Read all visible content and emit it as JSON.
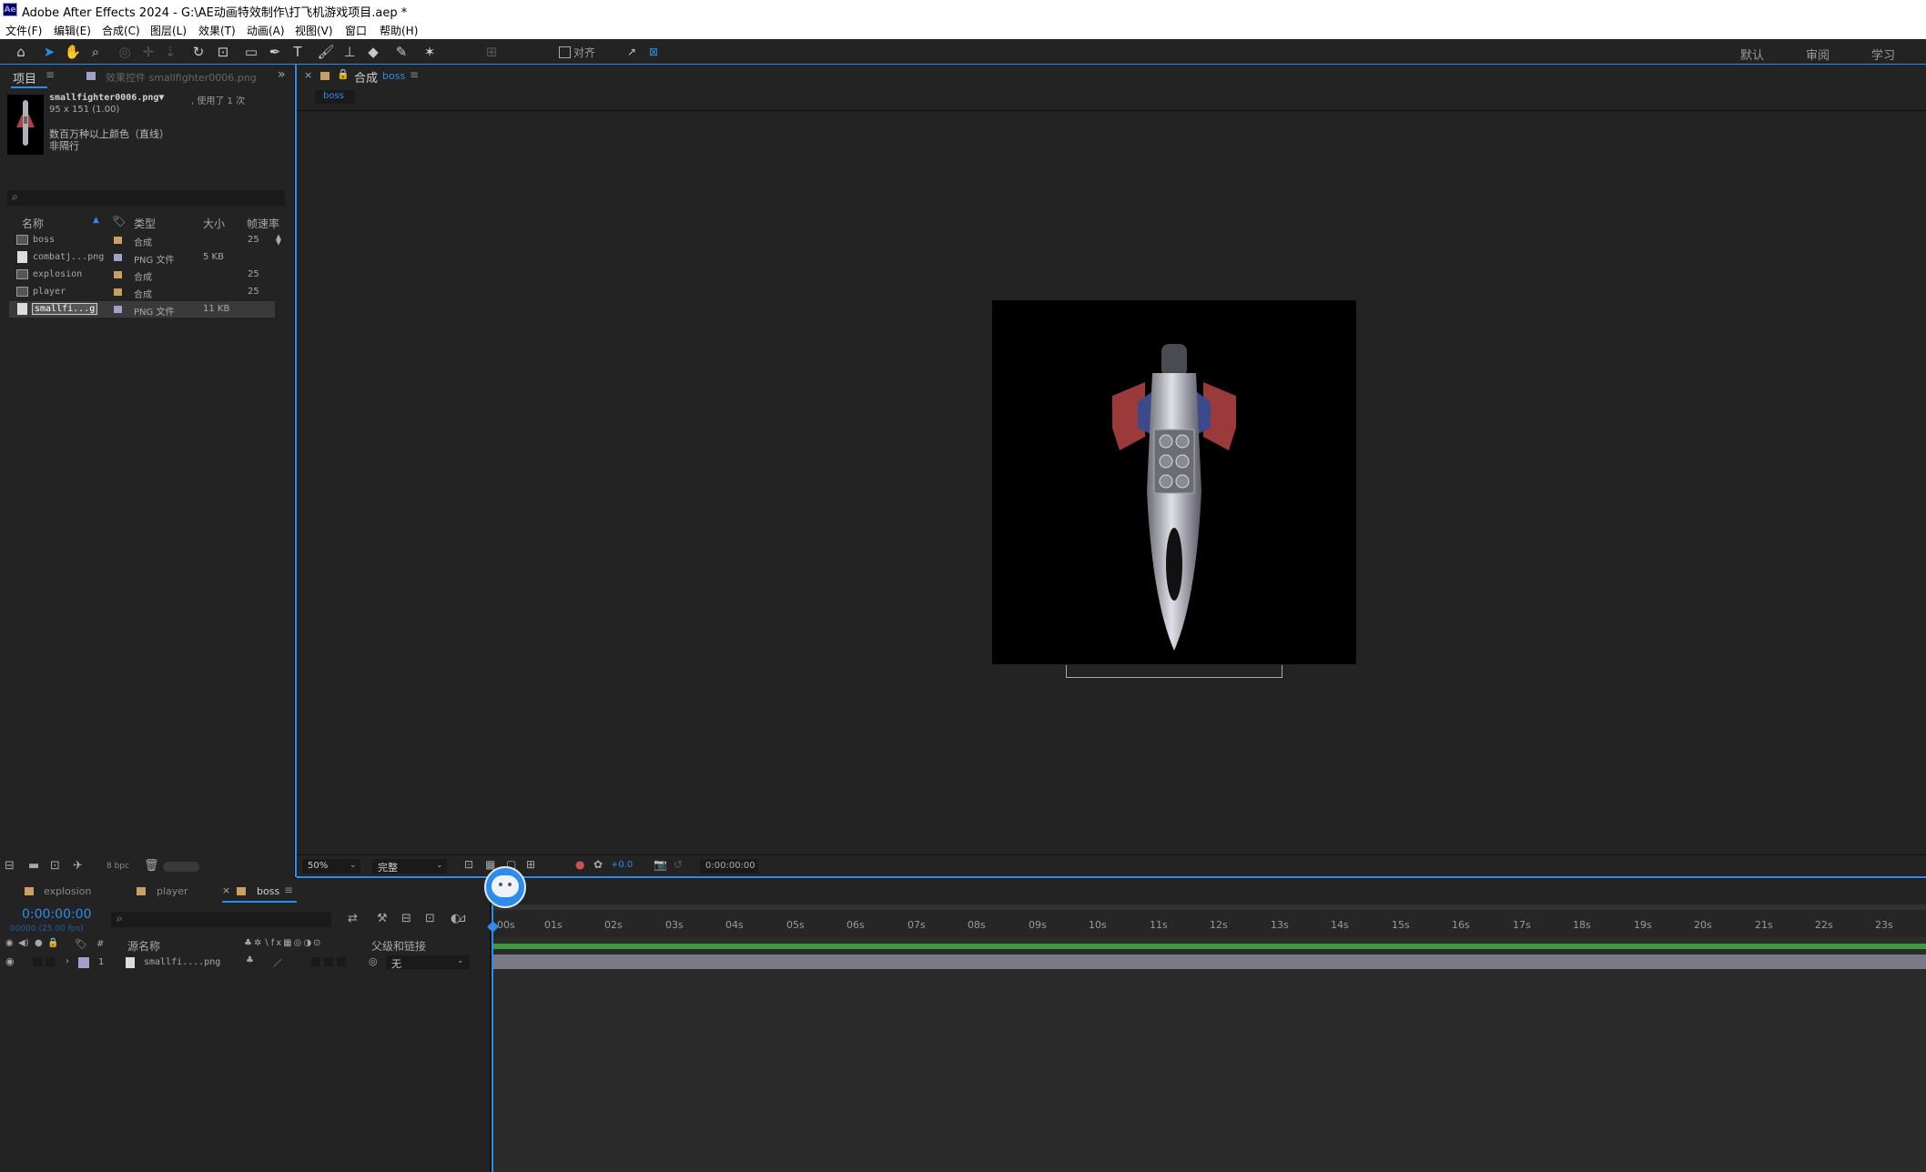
{
  "window": {
    "app_icon_text": "Ae",
    "title": "Adobe After Effects 2024 - G:\\AE动画特效制作\\打飞机游戏项目.aep *"
  },
  "menu": [
    "文件(F)",
    "编辑(E)",
    "合成(C)",
    "图层(L)",
    "效果(T)",
    "动画(A)",
    "视图(V)",
    "窗口",
    "帮助(H)"
  ],
  "toolbar": {
    "tools": [
      "home-icon",
      "selection-arrow-icon",
      "hand-icon",
      "zoom-icon",
      "orbit-camera-icon",
      "pan-camera-icon",
      "dolly-camera-icon",
      "rotate-icon",
      "anchor-point-icon",
      "rectangle-icon",
      "pen-icon",
      "type-icon",
      "brush-icon",
      "clone-stamp-icon",
      "eraser-icon",
      "roto-brush-icon",
      "puppet-pin-icon"
    ],
    "snap_label": "对齐",
    "workspaces": [
      "默认",
      "审阅",
      "学习"
    ]
  },
  "project_panel": {
    "tab_label": "项目",
    "effects_tab": "效果控件 smallfighter0006.png",
    "selected_name": "smallfighter0006.png▼",
    "selected_usage": ", 使用了 1 次",
    "selected_dims": "95 x 151 (1.00)",
    "selected_colors": "数百万种以上颜色（直线）",
    "selected_interlace": "非隔行",
    "search_placeholder": "",
    "columns": [
      "名称",
      "类型",
      "大小",
      "帧速率"
    ],
    "items": [
      {
        "name": "boss",
        "type": "合成",
        "size": "",
        "fps": "25",
        "kind": "comp",
        "color": "#c8a064"
      },
      {
        "name": "combatj...png",
        "type": "PNG 文件",
        "size": "5 KB",
        "fps": "",
        "kind": "file",
        "color": "#a0a0c8"
      },
      {
        "name": "explosion",
        "type": "合成",
        "size": "",
        "fps": "25",
        "kind": "comp",
        "color": "#c8a064"
      },
      {
        "name": "player",
        "type": "合成",
        "size": "",
        "fps": "25",
        "kind": "comp",
        "color": "#c8a064"
      },
      {
        "name": "smallfi...g",
        "type": "PNG 文件",
        "size": "11 KB",
        "fps": "",
        "kind": "file",
        "color": "#a0a0c8"
      }
    ],
    "bpc": "8 bpc"
  },
  "comp_panel": {
    "tab_prefix": "合成",
    "tab_name": "boss",
    "sub_tab": "boss",
    "zoom": "50%",
    "quality": "完整",
    "exposure": "+0.0",
    "timecode": "0:00:00:00"
  },
  "timeline": {
    "tabs": [
      "explosion",
      "player",
      "boss"
    ],
    "timecode": "0:00:00:00",
    "frame_info": "00000 (25.00 fps)",
    "search_placeholder": "",
    "col_source": "源名称",
    "col_parent": "父级和链接",
    "layer": {
      "index": "1",
      "name": "smallfi....png",
      "parent": "无"
    },
    "ticks": [
      "00s",
      "01s",
      "02s",
      "03s",
      "04s",
      "05s",
      "06s",
      "07s",
      "08s",
      "09s",
      "10s",
      "11s",
      "12s",
      "13s",
      "14s",
      "15s",
      "16s",
      "17s",
      "18s",
      "19s",
      "20s",
      "21s",
      "22s",
      "23s"
    ]
  },
  "colors": {
    "accent": "#2d8ceb",
    "work_area": "#3d9a3d",
    "layer_bar": "#7a7a86"
  }
}
